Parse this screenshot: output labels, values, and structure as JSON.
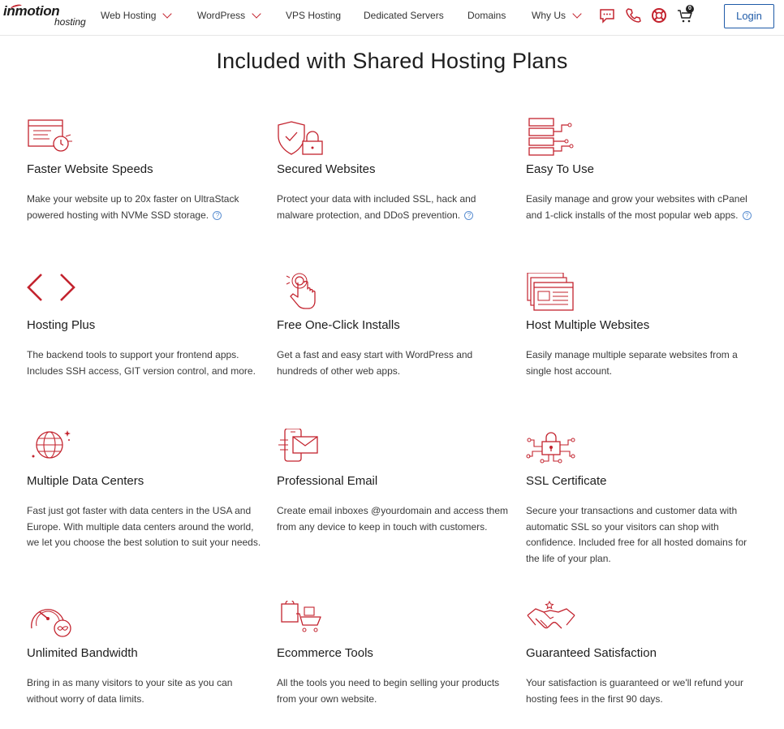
{
  "brand": {
    "name_top": "inmotion",
    "name_bottom": "hosting"
  },
  "nav": {
    "items": [
      {
        "label": "Web Hosting",
        "dropdown": true
      },
      {
        "label": "WordPress",
        "dropdown": true
      },
      {
        "label": "VPS Hosting",
        "dropdown": false
      },
      {
        "label": "Dedicated Servers",
        "dropdown": false
      },
      {
        "label": "Domains",
        "dropdown": false
      },
      {
        "label": "Why Us",
        "dropdown": true
      }
    ],
    "icons": [
      "chat-icon",
      "phone-icon",
      "lifebuoy-icon",
      "cart-icon"
    ],
    "cart_count": "0",
    "login_label": "Login"
  },
  "page": {
    "title": "Included with Shared Hosting Plans"
  },
  "features": [
    {
      "icon": "speed-clock-icon",
      "title": "Faster Website Speeds",
      "desc": "Make your website up to 20x faster on UltraStack powered hosting with NVMe SSD storage.",
      "help": true
    },
    {
      "icon": "shield-lock-icon",
      "title": "Secured Websites",
      "desc": "Protect your data with included SSL, hack and malware protection, and DDoS prevention.",
      "help": true
    },
    {
      "icon": "server-network-icon",
      "title": "Easy To Use",
      "desc": "Easily manage and grow your websites with cPanel and 1-click installs of the most popular web apps.",
      "help": true
    },
    {
      "icon": "code-brackets-icon",
      "title": "Hosting Plus",
      "desc": "The backend tools to support your frontend apps. Includes SSH access, GIT version control, and more.",
      "help": false
    },
    {
      "icon": "touch-click-icon",
      "title": "Free One-Click Installs",
      "desc": "Get a fast and easy start with WordPress and hundreds of other web apps.",
      "help": false
    },
    {
      "icon": "multi-window-icon",
      "title": "Host Multiple Websites",
      "desc": "Easily manage multiple separate websites from a single host account.",
      "help": false
    },
    {
      "icon": "globe-icon",
      "title": "Multiple Data Centers",
      "desc": "Fast just got faster with data centers in the USA and Europe. With multiple data centers around the world, we let you choose the best solution to suit your needs.",
      "help": false
    },
    {
      "icon": "email-phone-icon",
      "title": "Professional Email",
      "desc": "Create email inboxes @yourdomain and access them from any device to keep in touch with customers.",
      "help": false
    },
    {
      "icon": "ssl-lock-icon",
      "title": "SSL Certificate",
      "desc": "Secure your transactions and customer data with automatic SSL so your visitors can shop with confidence. Included free for all hosted domains for the life of your plan.",
      "help": false
    },
    {
      "icon": "gauge-infinity-icon",
      "title": "Unlimited Bandwidth",
      "desc": "Bring in as many visitors to your site as you can without worry of data limits.",
      "help": false
    },
    {
      "icon": "shopping-cart-icon",
      "title": "Ecommerce Tools",
      "desc": "All the tools you need to begin selling your products from your own website.",
      "help": false
    },
    {
      "icon": "handshake-icon",
      "title": "Guaranteed Satisfaction",
      "desc": "Your satisfaction is guaranteed or we'll refund your hosting fees in the first 90 days.",
      "help": false
    }
  ],
  "colors": {
    "accent": "#c3232e",
    "login_blue": "#1f5ba8",
    "help_blue": "#5b8fd1"
  }
}
